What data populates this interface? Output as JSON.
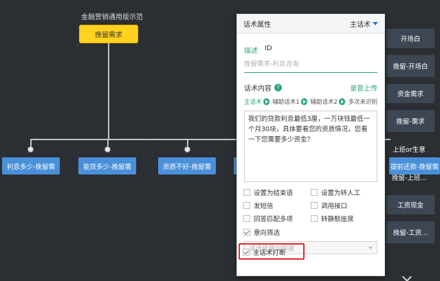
{
  "flow": {
    "title": "金融营销通用版示范",
    "root_node": "挽留需求",
    "children": [
      "利息多少-挽留需",
      "能贷多少-挽留需",
      "资质不好-挽留需"
    ]
  },
  "right_nodes": [
    "开场白",
    "挽留-开场白",
    "资金需求",
    "挽留-需求",
    "挽留-上班...",
    "工资现金",
    "挽留-工资..."
  ],
  "right_overlap": [
    "上班or生意",
    "提前还款-挽留需"
  ],
  "panel": {
    "title": "话术属性",
    "type_select": "主话术",
    "tabs": [
      "描述",
      "ID"
    ],
    "desc_placeholder": "挽留需求-利息咨询",
    "section_label": "话术内容",
    "help": "?",
    "upload": "录音上传",
    "steps": [
      "主话术",
      "辅助话术1",
      "辅助话术2",
      "多次未识别"
    ],
    "content": "我们的贷款利息最低3厘，一万块钱最低一个月30块，具体要看您的资质情况，您看一下您需要多少资金？",
    "options": [
      {
        "label": "设置为结束语",
        "checked": false
      },
      {
        "label": "设置为转人工",
        "checked": false
      },
      {
        "label": "发短信",
        "checked": false
      },
      {
        "label": "调用接口",
        "checked": false
      },
      {
        "label": "回答匹配多项",
        "checked": false
      },
      {
        "label": "转静默座席",
        "checked": false
      }
    ],
    "intent_filter": {
      "label": "意向筛选",
      "checked": true
    },
    "intent_placeholder": "请选择意向程度",
    "main_break": {
      "label": "主话术打断",
      "checked": true
    }
  }
}
